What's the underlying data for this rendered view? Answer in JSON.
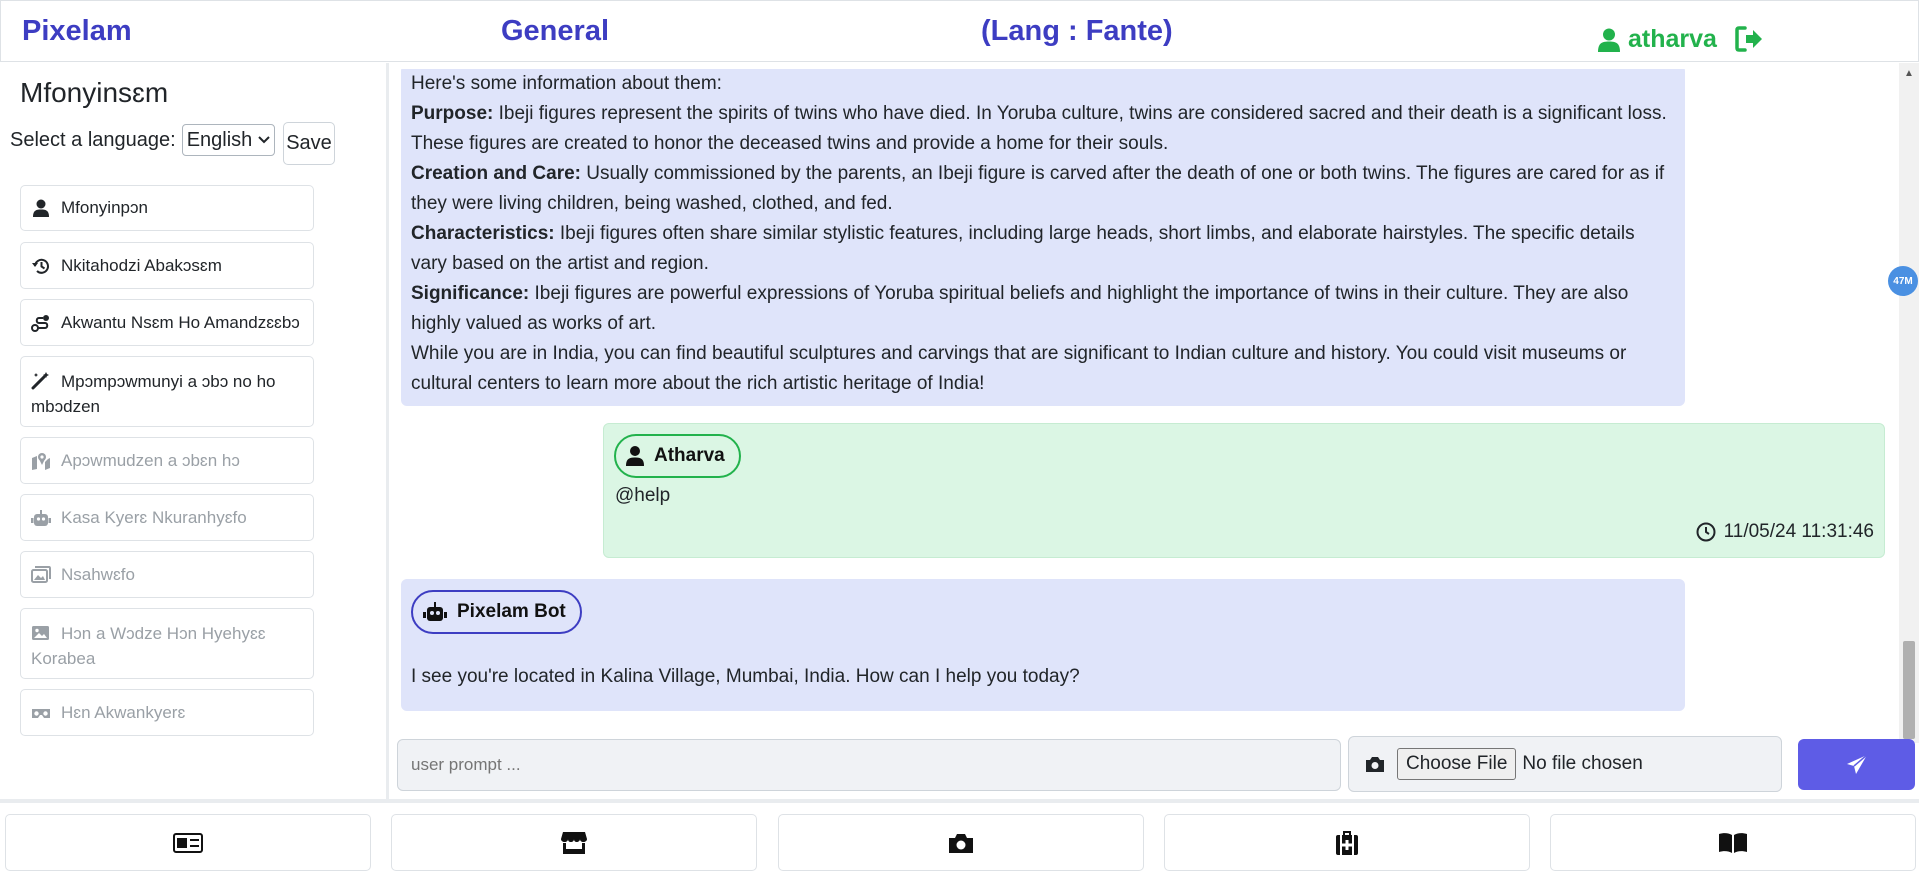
{
  "header": {
    "brand": "Pixelam",
    "room": "General",
    "language": "(Lang : Fante)",
    "username": "atharva",
    "user_icon": "user-icon",
    "logout_icon": "logout-icon"
  },
  "sidebar": {
    "title": "Mfonyinsɛm",
    "language_label": "Select a language:",
    "language_selected": "English",
    "save_label": "Save",
    "items": [
      {
        "label": "Mfonyinpɔn",
        "icon": "user-icon",
        "enabled": true
      },
      {
        "label": "Nkitahodzi Abakɔsɛm",
        "icon": "history-icon",
        "enabled": true
      },
      {
        "label": "Akwantu Nsɛm Ho Amandzɛɛbɔ",
        "icon": "route-icon",
        "enabled": true
      },
      {
        "label": "Mpɔmpɔwmunyi a ɔbɔ no ho mbɔdzen",
        "icon": "magic-wand-icon",
        "enabled": true
      },
      {
        "label": "Apɔwmudzen a ɔbɛn hɔ",
        "icon": "map-location-icon",
        "enabled": false
      },
      {
        "label": "Kasa Kyerɛ Nkuranhyɛfo",
        "icon": "robot-icon",
        "enabled": false
      },
      {
        "label": "Nsahwɛfo",
        "icon": "images-icon",
        "enabled": false
      },
      {
        "label": "Hɔn a Wɔdze Hɔn Hyehyɛɛ Korabea",
        "icon": "image-icon",
        "enabled": false
      },
      {
        "label": "Hɛn Akwankyerɛ",
        "icon": "vr-headset-icon",
        "enabled": false
      }
    ]
  },
  "chat": {
    "bot_message_1": {
      "intro": "Here's some information about them:",
      "purpose_label": "Purpose:",
      "purpose_text": " Ibeji figures represent the spirits of twins who have died. In Yoruba culture, twins are considered sacred and their death is a significant loss. These figures are created to honor the deceased twins and provide a home for their souls.",
      "creation_label": "Creation and Care:",
      "creation_text": " Usually commissioned by the parents, an Ibeji figure is carved after the death of one or both twins. The figures are cared for as if they were living children, being washed, clothed, and fed.",
      "characteristics_label": "Characteristics:",
      "characteristics_text": " Ibeji figures often share similar stylistic features, including large heads, short limbs, and elaborate hairstyles. The specific details vary based on the artist and region.",
      "significance_label": "Significance:",
      "significance_text": " Ibeji figures are powerful expressions of Yoruba spiritual beliefs and highlight the importance of twins in their culture. They are also highly valued as works of art.",
      "closing": "While you are in India, you can find beautiful sculptures and carvings that are significant to Indian culture and history. You could visit museums or cultural centers to learn more about the rich artistic heritage of India!"
    },
    "user_message": {
      "sender": "Atharva",
      "text": "@help",
      "timestamp": "11/05/24 11:31:46"
    },
    "bot_message_2": {
      "sender": "Pixelam Bot",
      "text": "I see you're located in Kalina Village, Mumbai, India. How can I help you today?"
    },
    "badge": "47M"
  },
  "input": {
    "placeholder": "user prompt ...",
    "choose_file_label": "Choose File",
    "no_file_label": "No file chosen"
  },
  "bottom_nav": {
    "icons": [
      "id-card-icon",
      "store-icon",
      "camera-icon",
      "medical-kit-icon",
      "book-icon"
    ]
  },
  "colors": {
    "brand": "#3d3dc2",
    "user_green": "#22b24c",
    "bot_bubble": "#dfe4fa",
    "user_bubble": "#dbf6e4",
    "send_button": "#5e5ce6"
  }
}
